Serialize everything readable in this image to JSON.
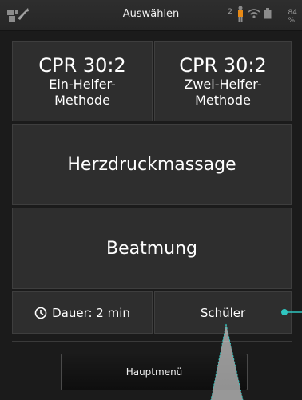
{
  "statusbar": {
    "title": "Auswählen",
    "signal_number": "2",
    "battery_percent": "84 %",
    "icons": [
      "tools-icon",
      "person-icon",
      "wifi-icon",
      "battery-icon"
    ]
  },
  "tiles": {
    "cpr_one": {
      "line1": "CPR 30:2",
      "line2": "Ein-Helfer-",
      "line3": "Methode"
    },
    "cpr_two": {
      "line1": "CPR 30:2",
      "line2": "Zwei-Helfer-",
      "line3": "Methode"
    },
    "compressions": {
      "label": "Herzdruckmassage"
    },
    "ventilation": {
      "label": "Beatmung"
    },
    "duration": {
      "label": "Dauer: 2 min",
      "icon": "timer-icon"
    },
    "student": {
      "label": "Schüler"
    }
  },
  "bottom": {
    "main_menu_label": "Hauptmenü"
  },
  "colors": {
    "background": "#1b1b1b",
    "tile": "#2e2e2e",
    "callout": "#2fc6c0"
  }
}
